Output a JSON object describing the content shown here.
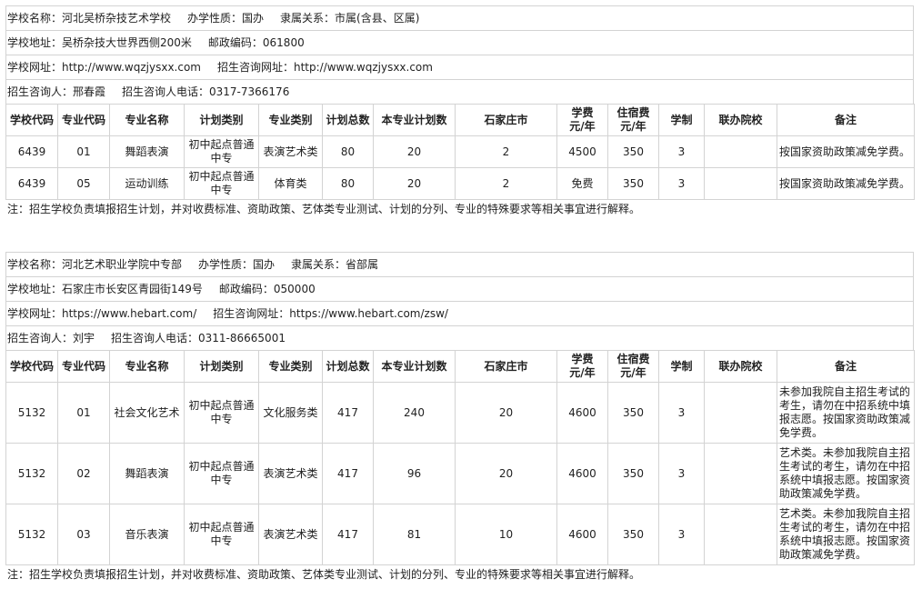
{
  "headers": [
    "学校代码",
    "专业代码",
    "专业名称",
    "计划类别",
    "专业类别",
    "计划总数",
    "本专业计划数",
    "石家庄市",
    "学费\n元/年",
    "住宿费\n元/年",
    "学制",
    "联办院校",
    "备注"
  ],
  "footnote": "注：招生学校负责填报招生计划，并对收费标准、资助政策、艺体类专业测试、计划的分列、专业的特殊要求等相关事宜进行解释。",
  "schools": [
    {
      "name_label": "学校名称：河北吴桥杂技艺术学校",
      "nature_label": "办学性质：国办",
      "affiliation_label": "隶属关系：市属(含县、区属)",
      "address_label": "学校地址：吴桥杂技大世界西侧200米",
      "postcode_label": "邮政编码：061800",
      "website_label": "学校网址：http://www.wqzjysxx.com",
      "enroll_site_label": "招生咨询网址：http://www.wqzjysxx.com",
      "contact_label": "招生咨询人：邢春霞",
      "phone_label": "招生咨询人电话：0317-7366176",
      "rows": [
        {
          "code": "6439",
          "major_code": "01",
          "major": "舞蹈表演",
          "plan_type": "初中起点普通中专",
          "category": "表演艺术类",
          "total": "80",
          "major_plan": "20",
          "sjz": "2",
          "tuition": "4500",
          "lodging": "350",
          "years": "3",
          "partner": "",
          "note": "按国家资助政策减免学费。"
        },
        {
          "code": "6439",
          "major_code": "05",
          "major": "运动训练",
          "plan_type": "初中起点普通中专",
          "category": "体育类",
          "total": "80",
          "major_plan": "20",
          "sjz": "2",
          "tuition": "免费",
          "lodging": "350",
          "years": "3",
          "partner": "",
          "note": "按国家资助政策减免学费。"
        }
      ]
    },
    {
      "name_label": "学校名称：河北艺术职业学院中专部",
      "nature_label": "办学性质：国办",
      "affiliation_label": "隶属关系：省部属",
      "address_label": "学校地址：石家庄市长安区青园街149号",
      "postcode_label": "邮政编码：050000",
      "website_label": "学校网址：https://www.hebart.com/",
      "enroll_site_label": "招生咨询网址：https://www.hebart.com/zsw/",
      "contact_label": "招生咨询人：刘宇",
      "phone_label": "招生咨询人电话：0311-86665001",
      "rows": [
        {
          "code": "5132",
          "major_code": "01",
          "major": "社会文化艺术",
          "plan_type": "初中起点普通中专",
          "category": "文化服务类",
          "total": "417",
          "major_plan": "240",
          "sjz": "20",
          "tuition": "4600",
          "lodging": "350",
          "years": "3",
          "partner": "",
          "note": "未参加我院自主招生考试的考生，请勿在中招系统中填报志愿。按国家资助政策减免学费。"
        },
        {
          "code": "5132",
          "major_code": "02",
          "major": "舞蹈表演",
          "plan_type": "初中起点普通中专",
          "category": "表演艺术类",
          "total": "417",
          "major_plan": "96",
          "sjz": "20",
          "tuition": "4600",
          "lodging": "350",
          "years": "3",
          "partner": "",
          "note": "艺术类。未参加我院自主招生考试的考生，请勿在中招系统中填报志愿。按国家资助政策减免学费。"
        },
        {
          "code": "5132",
          "major_code": "03",
          "major": "音乐表演",
          "plan_type": "初中起点普通中专",
          "category": "表演艺术类",
          "total": "417",
          "major_plan": "81",
          "sjz": "10",
          "tuition": "4600",
          "lodging": "350",
          "years": "3",
          "partner": "",
          "note": "艺术类。未参加我院自主招生考试的考生，请勿在中招系统中填报志愿。按国家资助政策减免学费。"
        }
      ]
    }
  ]
}
